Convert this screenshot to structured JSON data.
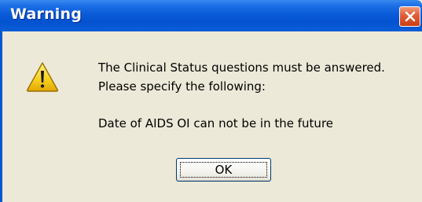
{
  "window": {
    "title": "Warning",
    "title_bar_color": "#0552cf",
    "close_icon": "close-icon"
  },
  "dialog": {
    "icon": "warning-icon",
    "message_lines": [
      "The Clinical Status questions must be answered.",
      "Please specify the following:",
      "Date of AIDS OI can not be in the future"
    ]
  },
  "buttons": {
    "ok_label": "OK"
  }
}
